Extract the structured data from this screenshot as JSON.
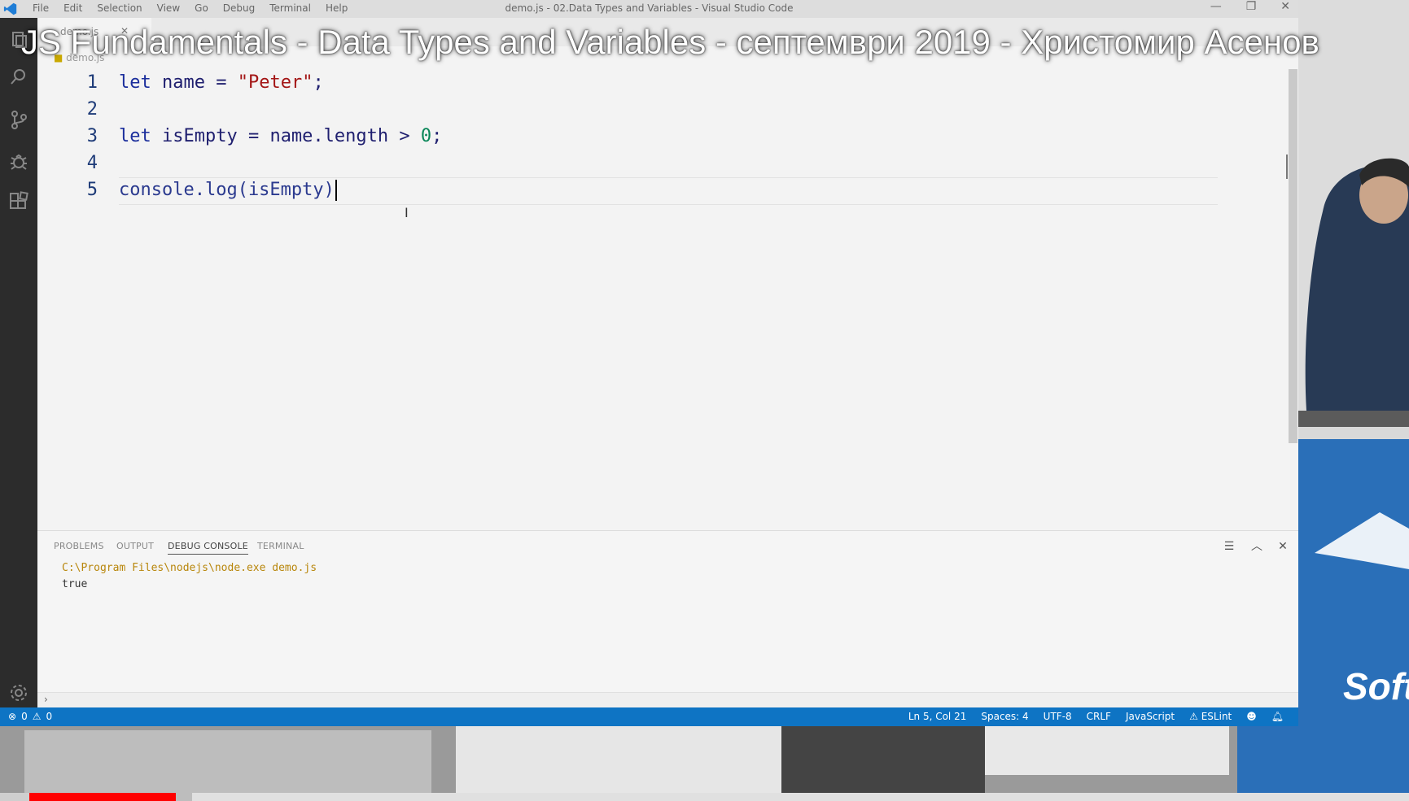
{
  "video": {
    "title": "JS Fundamentals - Data Types and Variables - септември 2019 - Христомир Асенов",
    "progress_fraction": 0.106,
    "buffered_fraction": 0.118,
    "progress_color": "#ff0000"
  },
  "window": {
    "title": "demo.js - 02.Data Types and Variables - Visual Studio Code",
    "menu": [
      "File",
      "Edit",
      "Selection",
      "View",
      "Go",
      "Debug",
      "Terminal",
      "Help"
    ]
  },
  "tabs": [
    {
      "label": "demo.js"
    }
  ],
  "breadcrumb": "demo.js",
  "code_lines": [
    {
      "num": "1"
    },
    {
      "num": "2"
    },
    {
      "num": "3"
    },
    {
      "num": "4"
    },
    {
      "num": "5"
    }
  ],
  "code_tokens": {
    "l1_kw": "let",
    "l1_rest": " name = ",
    "l1_str": "\"Peter\"",
    "l1_end": ";",
    "l3_kw": "let",
    "l3_rest": " isEmpty = name.length > ",
    "l3_num": "0",
    "l3_end": ";",
    "l5_text": "console.log(isEmpty)"
  },
  "panel": {
    "tabs": [
      "PROBLEMS",
      "OUTPUT",
      "DEBUG CONSOLE",
      "TERMINAL"
    ],
    "active_tab": "DEBUG CONSOLE",
    "console_lines": [
      "C:\\Program Files\\nodejs\\node.exe demo.js",
      "true"
    ],
    "prompt": "›"
  },
  "statusbar": {
    "errors": "0",
    "warnings": "0",
    "items": [
      "Ln 5, Col 21",
      "Spaces: 4",
      "UTF-8",
      "CRLF",
      "JavaScript",
      "ESLint"
    ],
    "color": "#0e74c4"
  },
  "colors": {
    "keyword": "#1b2e9c",
    "string": "#a31515",
    "number": "#098658"
  }
}
